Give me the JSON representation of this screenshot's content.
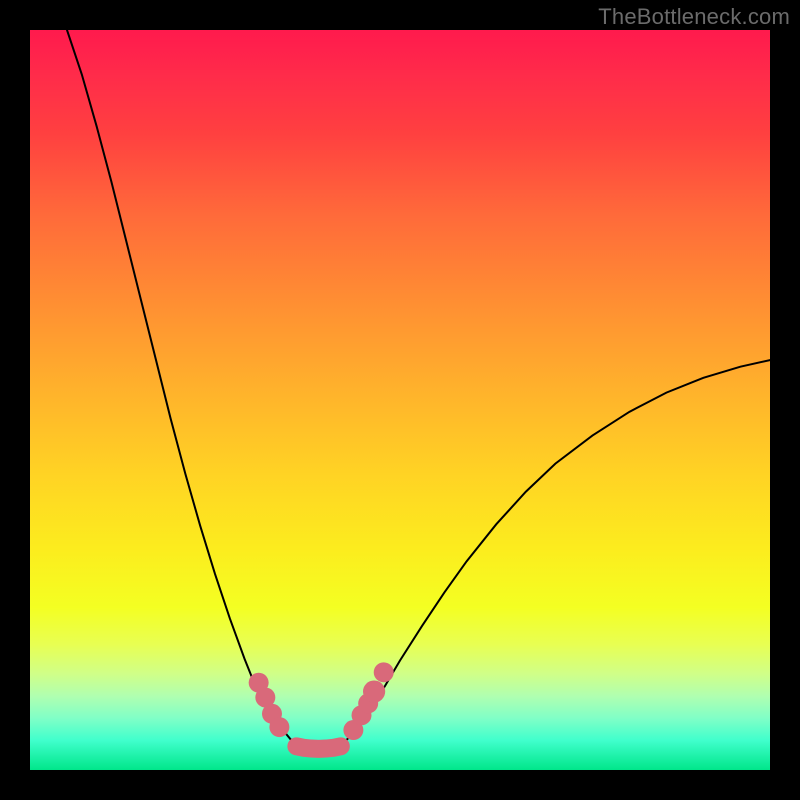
{
  "watermark": {
    "text": "TheBottleneck.com"
  },
  "chart_data": {
    "type": "line",
    "title": "",
    "xlabel": "",
    "ylabel": "",
    "xlim": [
      0,
      100
    ],
    "ylim": [
      0,
      100
    ],
    "background_gradient": {
      "orientation": "vertical",
      "stops": [
        {
          "pos": 0.0,
          "color": "#ff1a4d"
        },
        {
          "pos": 0.25,
          "color": "#ff6a3a"
        },
        {
          "pos": 0.5,
          "color": "#ffb82a"
        },
        {
          "pos": 0.7,
          "color": "#fcec1e"
        },
        {
          "pos": 0.82,
          "color": "#f4ff22"
        },
        {
          "pos": 0.9,
          "color": "#b0ffb0"
        },
        {
          "pos": 1.0,
          "color": "#00e68a"
        }
      ]
    },
    "series": [
      {
        "name": "left-branch",
        "stroke": "#000000",
        "x": [
          5,
          7,
          9,
          11,
          13,
          15,
          17,
          19,
          21,
          23,
          25,
          27,
          29,
          30,
          31,
          32.5,
          34,
          36
        ],
        "values": [
          100,
          94,
          87,
          79.5,
          71.5,
          63.5,
          55.5,
          47.5,
          40,
          33,
          26.5,
          20.5,
          15,
          12.5,
          10.3,
          7.6,
          5.6,
          3.2
        ]
      },
      {
        "name": "right-branch",
        "stroke": "#000000",
        "x": [
          42,
          44,
          46,
          48,
          50,
          53,
          56,
          59,
          63,
          67,
          71,
          76,
          81,
          86,
          91,
          96,
          100
        ],
        "values": [
          3.2,
          5.4,
          8.2,
          11.4,
          14.8,
          19.5,
          24,
          28.2,
          33.2,
          37.6,
          41.4,
          45.2,
          48.4,
          51,
          53,
          54.5,
          55.4
        ]
      },
      {
        "name": "trough-flat",
        "stroke": "#d9697a",
        "x": [
          36,
          37,
          38,
          39,
          40,
          41,
          42
        ],
        "values": [
          3.2,
          3.0,
          2.9,
          2.85,
          2.9,
          3.0,
          3.2
        ]
      }
    ],
    "markers": [
      {
        "name": "left-cluster-1",
        "shape": "circle",
        "color": "#d9697a",
        "x": 30.9,
        "y": 11.8,
        "r": 1.35
      },
      {
        "name": "left-cluster-2",
        "shape": "circle",
        "color": "#d9697a",
        "x": 31.8,
        "y": 9.8,
        "r": 1.35
      },
      {
        "name": "left-cluster-3",
        "shape": "circle",
        "color": "#d9697a",
        "x": 32.7,
        "y": 7.6,
        "r": 1.35
      },
      {
        "name": "left-cluster-4",
        "shape": "circle",
        "color": "#d9697a",
        "x": 33.7,
        "y": 5.8,
        "r": 1.35
      },
      {
        "name": "right-cluster-1",
        "shape": "circle",
        "color": "#d9697a",
        "x": 43.7,
        "y": 5.4,
        "r": 1.35
      },
      {
        "name": "right-cluster-2",
        "shape": "circle",
        "color": "#d9697a",
        "x": 44.8,
        "y": 7.4,
        "r": 1.35
      },
      {
        "name": "right-cluster-3",
        "shape": "circle",
        "color": "#d9697a",
        "x": 45.7,
        "y": 9.0,
        "r": 1.35
      },
      {
        "name": "right-cluster-4",
        "shape": "circle",
        "color": "#d9697a",
        "x": 46.5,
        "y": 10.6,
        "r": 1.5
      },
      {
        "name": "right-cluster-5",
        "shape": "circle",
        "color": "#d9697a",
        "x": 47.8,
        "y": 13.2,
        "r": 1.35
      }
    ]
  }
}
